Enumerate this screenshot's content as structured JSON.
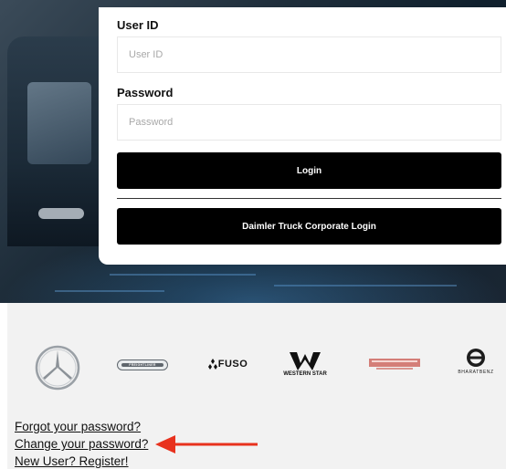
{
  "login": {
    "user_id_label": "User ID",
    "user_id_placeholder": "User ID",
    "user_id_value": "",
    "password_label": "Password",
    "password_placeholder": "Password",
    "password_value": "",
    "login_button": "Login",
    "corporate_login_button": "Daimler Truck Corporate Login"
  },
  "brands": {
    "items": [
      {
        "name": "mercedes-benz",
        "icon": "mercedes-star-icon"
      },
      {
        "name": "freightliner",
        "text": "FREIGHTLINER",
        "icon": "freightliner-logo-icon"
      },
      {
        "name": "fuso",
        "text": "FUSO",
        "icon": "fuso-diamond-icon"
      },
      {
        "name": "western-star",
        "text": "WESTERN STAR",
        "icon": "western-star-w-icon"
      },
      {
        "name": "thomas-built-buses",
        "icon": "thomas-built-buses-logo-icon"
      },
      {
        "name": "bharatbenz",
        "text": "BHARATBENZ",
        "icon": "bharatbenz-logo-icon"
      }
    ]
  },
  "links": {
    "forgot_password": "Forgot your password?",
    "change_password": "Change your password?",
    "register": "New User? Register!"
  },
  "colors": {
    "button_bg": "#000000",
    "annotation_arrow": "#e8321e",
    "brand_strip_bg": "#f2f2f2"
  }
}
